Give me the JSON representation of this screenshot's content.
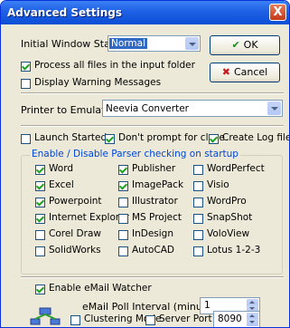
{
  "window": {
    "title": "Advanced Settings",
    "close_label": "X"
  },
  "general": {
    "initial_state_label": "Initial Window State:",
    "initial_state_value": "Normal",
    "process_all_label": "Process all files in the input folder",
    "display_warning_label": "Display Warning Messages"
  },
  "buttons": {
    "ok_label": "OK",
    "cancel_label": "Cancel"
  },
  "printer": {
    "label": "Printer to Emulate :",
    "value": "Neevia Converter"
  },
  "options": {
    "launch_started_label": "Launch Started",
    "dont_prompt_label": "Don't prompt for close",
    "create_log_label": "Create Log file"
  },
  "parsers": {
    "title": "Enable / Disable Parser checking on startup",
    "col1": [
      {
        "label": "Word",
        "checked": true
      },
      {
        "label": "Excel",
        "checked": true
      },
      {
        "label": "Powerpoint",
        "checked": true
      },
      {
        "label": "Internet Explorer",
        "checked": true
      },
      {
        "label": "Corel Draw",
        "checked": false
      },
      {
        "label": "SolidWorks",
        "checked": false
      }
    ],
    "col2": [
      {
        "label": "Publisher",
        "checked": true
      },
      {
        "label": "ImagePack",
        "checked": true
      },
      {
        "label": "Illustrator",
        "checked": false
      },
      {
        "label": "MS Project",
        "checked": false
      },
      {
        "label": "InDesign",
        "checked": false
      },
      {
        "label": "AutoCAD",
        "checked": false
      }
    ],
    "col3": [
      {
        "label": "WordPerfect",
        "checked": false
      },
      {
        "label": "Visio",
        "checked": false
      },
      {
        "label": "WordPro",
        "checked": false
      },
      {
        "label": "SnapShot",
        "checked": false
      },
      {
        "label": "VoloView",
        "checked": false
      },
      {
        "label": "Lotus 1-2-3",
        "checked": false
      }
    ]
  },
  "email": {
    "enable_label": "Enable eMail Watcher",
    "interval_label": "eMail Poll Interval (minutes) :",
    "interval_value": "1"
  },
  "cluster": {
    "clustering_label": "Clustering Mode",
    "server_port_label": "Server Port :",
    "server_port_value": "8090"
  },
  "colors": {
    "accent": "#0046d5",
    "titlebar": "#2163e7",
    "close": "#c2391a"
  }
}
